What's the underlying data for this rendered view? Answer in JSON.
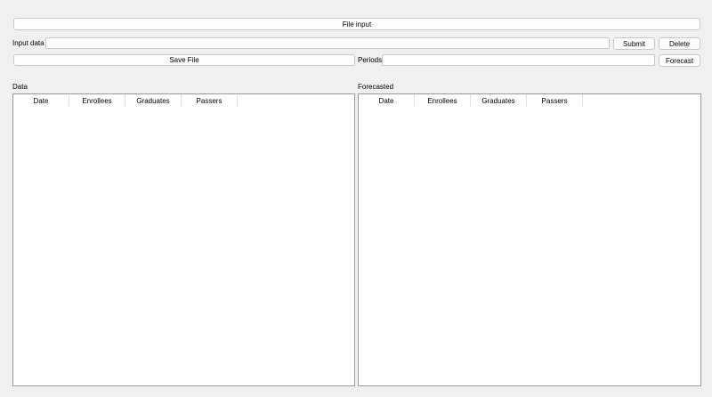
{
  "toolbar": {
    "file_input_label": "File input",
    "input_data_label": "Input data",
    "input_data_value": "",
    "submit_label": "Submit",
    "delete_label": "Delete",
    "save_file_label": "Save File",
    "periods_label": "Periods",
    "periods_value": "",
    "forecast_label": "Forecast"
  },
  "data_panel": {
    "title": "Data",
    "columns": [
      "Date",
      "Enrollees",
      "Graduates",
      "Passers"
    ]
  },
  "forecast_panel": {
    "title": "Forecasted",
    "columns": [
      "Date",
      "Enrollees",
      "Graduates",
      "Passers"
    ]
  }
}
